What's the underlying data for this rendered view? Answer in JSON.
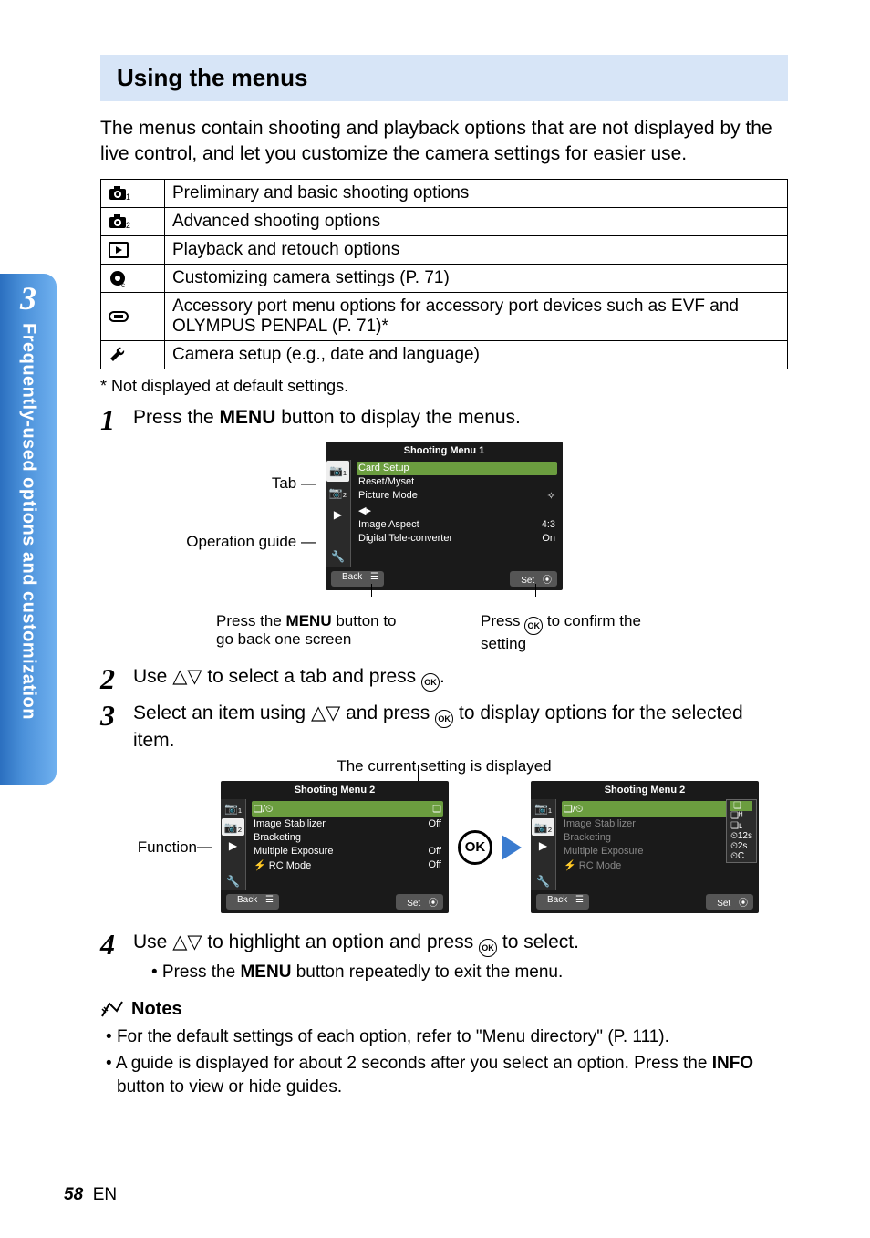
{
  "side": {
    "chapter": "3",
    "title": "Frequently-used options and customization"
  },
  "section_title": "Using the menus",
  "intro": "The menus contain shooting and playback options that are not displayed by the live control, and let you customize the camera settings for easier use.",
  "options_table": [
    {
      "icon": "camera1",
      "desc": "Preliminary and basic shooting options"
    },
    {
      "icon": "camera2",
      "desc": "Advanced shooting options"
    },
    {
      "icon": "playback",
      "desc": "Playback and retouch options"
    },
    {
      "icon": "gear",
      "desc": "Customizing camera settings (P. 71)"
    },
    {
      "icon": "accessory",
      "desc": "Accessory port menu options for accessory port devices such as EVF and OLYMPUS PENPAL (P. 71)*"
    },
    {
      "icon": "wrench",
      "desc": "Camera setup (e.g., date and language)"
    }
  ],
  "footnote": "*    Not displayed at default settings.",
  "steps": {
    "s1": {
      "pre": "Press the ",
      "btn": "MENU",
      "post": " button to display the menus."
    },
    "s2": {
      "pre": "Use ",
      "tri": "△▽",
      "mid": " to select a tab and press ",
      "ok": "OK",
      "post": "."
    },
    "s3": {
      "pre": "Select an item using ",
      "tri": "△▽",
      "mid": " and press ",
      "ok": "OK",
      "post": " to display options for the selected item."
    },
    "s4": {
      "pre": "Use ",
      "tri": "△▽",
      "mid": " to highlight an option and press ",
      "ok": "OK",
      "post": " to select."
    },
    "s4sub": {
      "pre": "• Press the ",
      "btn": "MENU",
      "post": " button repeatedly to exit the menu."
    }
  },
  "labels": {
    "tab": "Tab",
    "opguide": "Operation guide",
    "back_cap_pre": "Press the ",
    "back_cap_btn": "MENU",
    "back_cap_post": " button to go back one screen",
    "ok_cap_pre": "Press ",
    "ok_cap_post": " to confirm the setting",
    "current": "The current setting is displayed",
    "function": "Function"
  },
  "menu1": {
    "title": "Shooting Menu 1",
    "items": [
      {
        "label": "Card Setup",
        "val": ""
      },
      {
        "label": "Reset/Myset",
        "val": ""
      },
      {
        "label": "Picture Mode",
        "val": "✧"
      },
      {
        "label": "◀▸",
        "val": ""
      },
      {
        "label": "Image Aspect",
        "val": "4:3"
      },
      {
        "label": "Digital Tele-converter",
        "val": "On"
      }
    ],
    "back": "Back",
    "set": "Set"
  },
  "menu2a": {
    "title": "Shooting Menu 2",
    "items": [
      {
        "label": "❏/⏲",
        "val": "❏"
      },
      {
        "label": "Image Stabilizer",
        "val": "Off"
      },
      {
        "label": "Bracketing",
        "val": ""
      },
      {
        "label": "Multiple Exposure",
        "val": "Off"
      },
      {
        "label": "⚡ RC Mode",
        "val": "Off"
      }
    ],
    "back": "Back",
    "set": "Set"
  },
  "menu2b": {
    "title": "Shooting Menu 2",
    "items": [
      {
        "label": "❏/⏲",
        "val": ""
      },
      {
        "label": "Image Stabilizer",
        "val": ""
      },
      {
        "label": "Bracketing",
        "val": ""
      },
      {
        "label": "Multiple Exposure",
        "val": ""
      },
      {
        "label": "⚡ RC Mode",
        "val": ""
      }
    ],
    "popup": [
      "❏",
      "❏ᴴ",
      "❏ʟ",
      "⏲12s",
      "⏲2s",
      "⏲C"
    ],
    "back": "Back",
    "set": "Set"
  },
  "notes": {
    "title": "Notes",
    "items": [
      {
        "text": "For the default settings of each option, refer to \"Menu directory\" (P. 111)."
      },
      {
        "pre": "A guide is displayed for about 2 seconds after you select an option. Press the ",
        "btn": "INFO",
        "post": " button to view or hide guides."
      }
    ]
  },
  "page": {
    "num": "58",
    "lang": "EN"
  }
}
